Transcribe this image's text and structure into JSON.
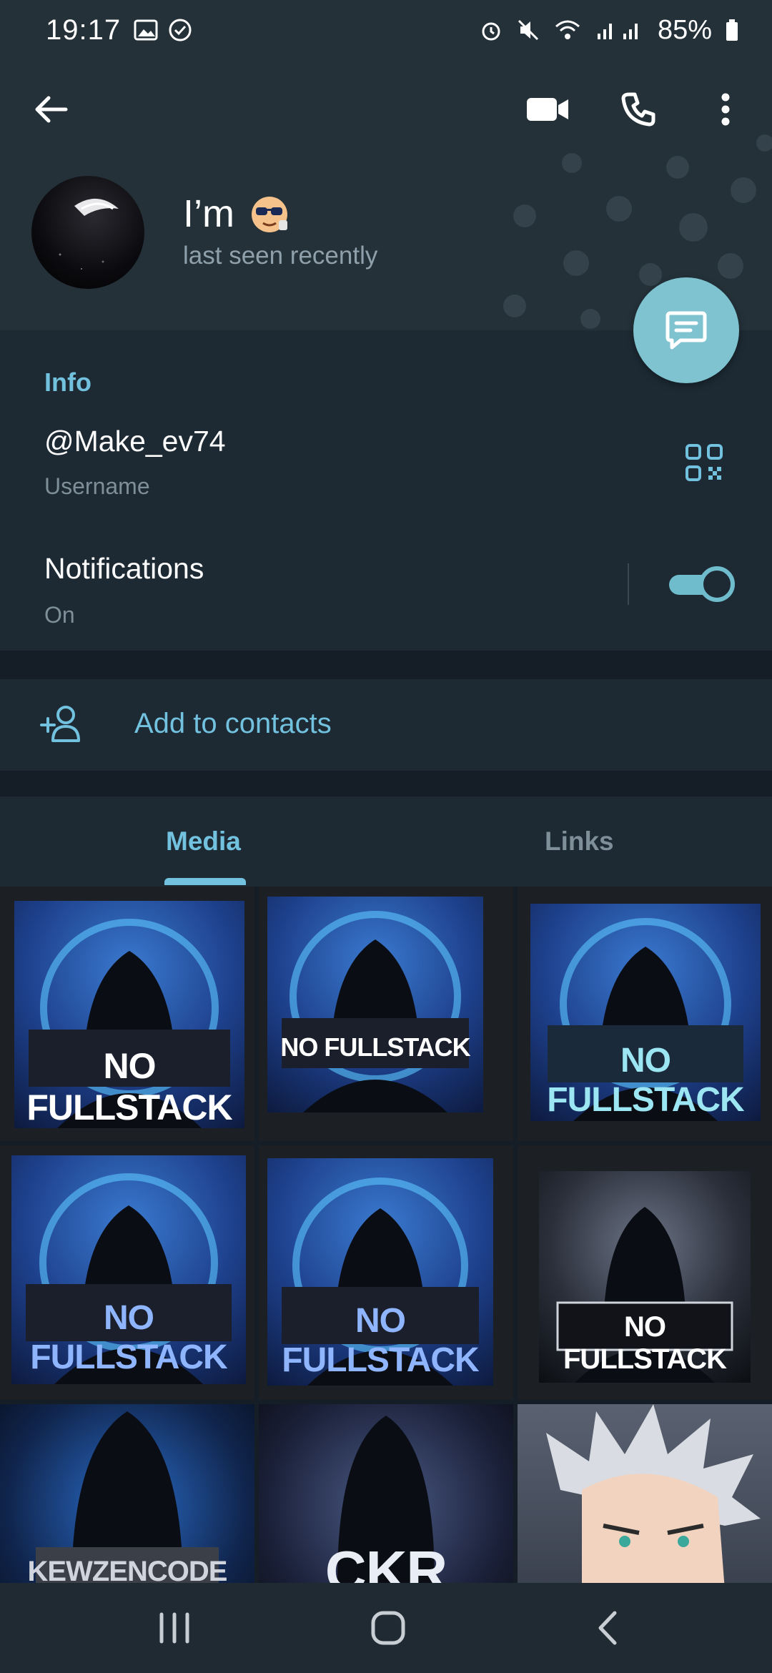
{
  "status_bar": {
    "time": "19:17",
    "battery": "85%"
  },
  "profile": {
    "name": "I’m",
    "status": "last seen recently"
  },
  "info": {
    "section_title": "Info",
    "username": "@Make_ev74",
    "username_label": "Username",
    "notifications_title": "Notifications",
    "notifications_state": "On",
    "notifications_enabled": true
  },
  "actions": {
    "add_contact": "Add to contacts"
  },
  "tabs": [
    {
      "label": "Media",
      "active": true
    },
    {
      "label": "Links",
      "active": false
    }
  ],
  "media": [
    {
      "caption": "NO FULLSTACK"
    },
    {
      "caption": "NO FULLSTACK"
    },
    {
      "caption": "NO FULLSTACK"
    },
    {
      "caption": "NO FULLSTACK"
    },
    {
      "caption": "NO FULLSTACK"
    },
    {
      "caption": "NO FULLSTACK"
    },
    {
      "caption": "KEWZENCODE"
    },
    {
      "caption": "CKR"
    },
    {
      "caption": ""
    }
  ],
  "colors": {
    "accent": "#72c2df",
    "fab": "#7ec3cf",
    "header_bg": "#243139",
    "section_bg": "#1d2a34"
  }
}
